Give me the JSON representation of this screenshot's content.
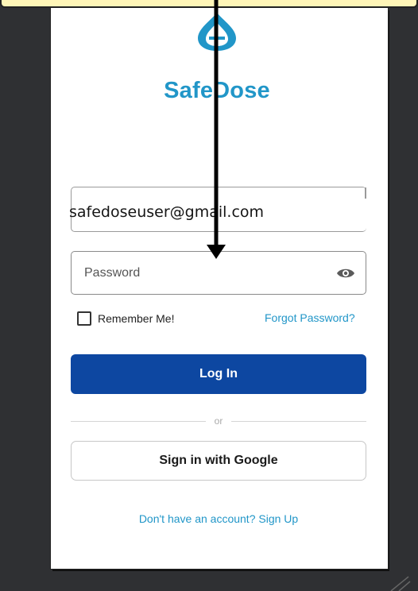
{
  "app": {
    "name": "SafeDose"
  },
  "login": {
    "email_value": "safedoseuser@gmail.com",
    "password_placeholder": "Password",
    "remember_label": "Remember Me!",
    "forgot_label": "Forgot Password?",
    "login_label": "Log In",
    "divider_text": "or",
    "google_label": "Sign in with Google",
    "signup_label": "Don't have an account? Sign Up"
  },
  "icons": {
    "logo": "drop-plus-logo-icon",
    "password_visibility": "eye-icon",
    "overlay_arrow": "arrow-down-icon"
  },
  "colors": {
    "brand": "#2196c8",
    "primary_button": "#0d47a1",
    "background": "#2f3033"
  }
}
